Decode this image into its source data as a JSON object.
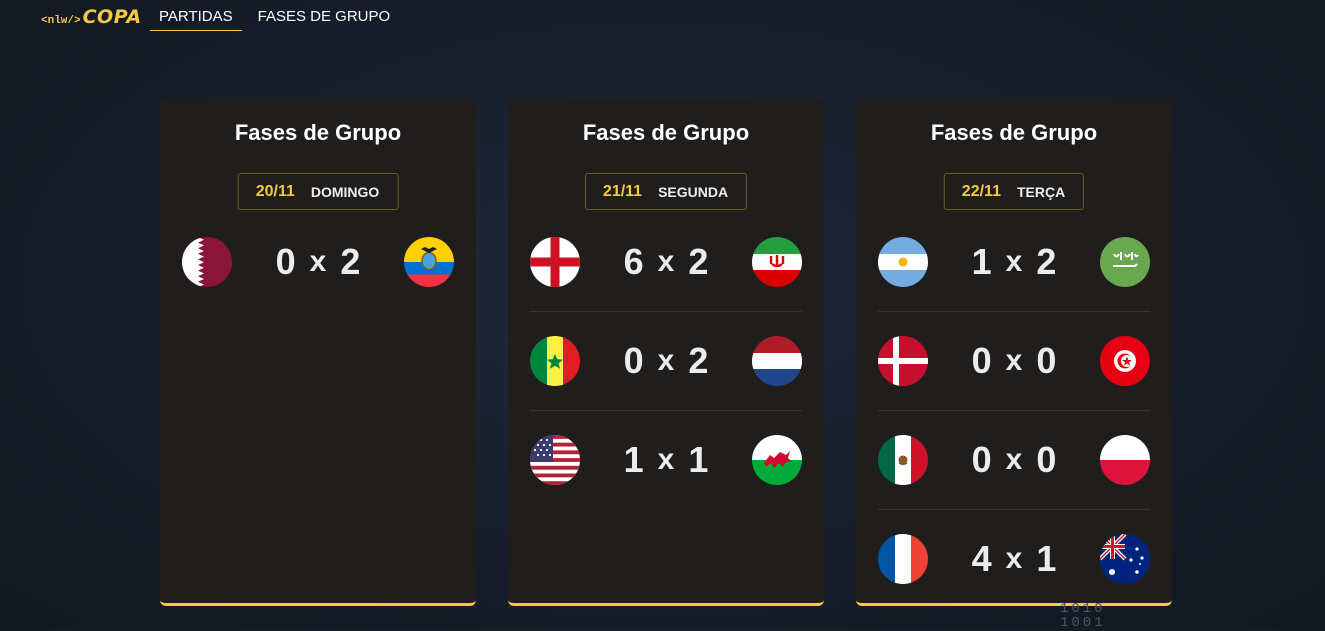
{
  "header": {
    "logo_tag": "<nlw/>",
    "logo_name": "COPA",
    "nav": [
      {
        "label": "PARTIDAS"
      },
      {
        "label": "FASES DE GRUPO"
      }
    ]
  },
  "cards": [
    {
      "title": "Fases de Grupo",
      "date": "20/11",
      "weekday": "DOMINGO",
      "matches": [
        {
          "home": "qatar-flag",
          "home_score": "0",
          "sep": "x",
          "away_score": "2",
          "away": "ecuador-flag"
        }
      ]
    },
    {
      "title": "Fases de Grupo",
      "date": "21/11",
      "weekday": "SEGUNDA",
      "matches": [
        {
          "home": "england-flag",
          "home_score": "6",
          "sep": "x",
          "away_score": "2",
          "away": "iran-flag"
        },
        {
          "home": "senegal-flag",
          "home_score": "0",
          "sep": "x",
          "away_score": "2",
          "away": "netherlands-flag"
        },
        {
          "home": "usa-flag",
          "home_score": "1",
          "sep": "x",
          "away_score": "1",
          "away": "wales-flag"
        }
      ]
    },
    {
      "title": "Fases de Grupo",
      "date": "22/11",
      "weekday": "TERÇA",
      "matches": [
        {
          "home": "argentina-flag",
          "home_score": "1",
          "sep": "x",
          "away_score": "2",
          "away": "saudi-arabia-flag"
        },
        {
          "home": "denmark-flag",
          "home_score": "0",
          "sep": "x",
          "away_score": "0",
          "away": "tunisia-flag"
        },
        {
          "home": "mexico-flag",
          "home_score": "0",
          "sep": "x",
          "away_score": "0",
          "away": "poland-flag"
        },
        {
          "home": "france-flag",
          "home_score": "4",
          "sep": "x",
          "away_score": "1",
          "away": "australia-flag"
        }
      ]
    }
  ],
  "background_text": [
    "1010",
    "1001"
  ],
  "colors": {
    "accent": "#f6c945",
    "card": "#201e1d",
    "background": "#18202d"
  }
}
